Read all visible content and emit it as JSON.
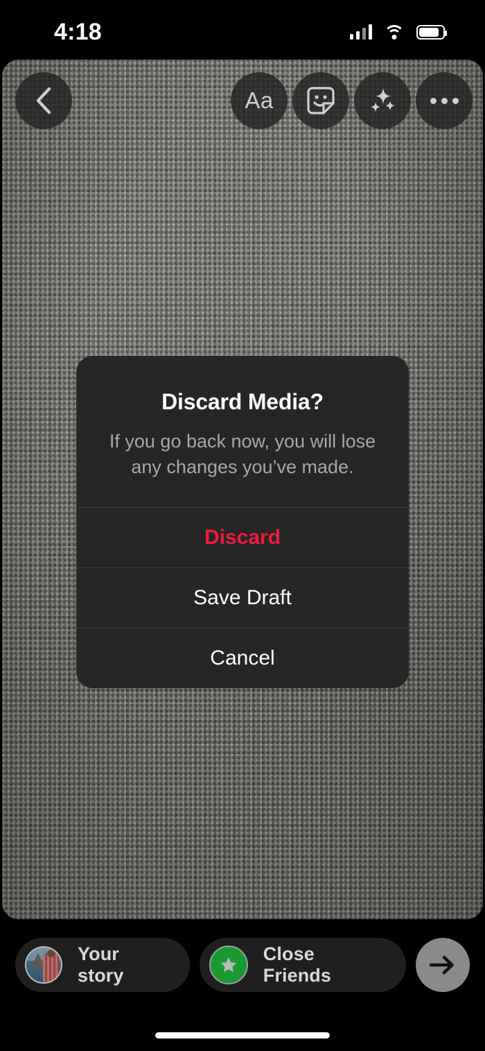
{
  "status_bar": {
    "time": "4:18",
    "icons": [
      "cellular-signal-icon",
      "wifi-icon",
      "battery-icon"
    ],
    "battery_level_percent": 85
  },
  "editor": {
    "toolbar": {
      "back_icon": "chevron-left-icon",
      "text_tool_label": "Aa",
      "text_tool_icon": "text-tool-icon",
      "sticker_icon": "sticker-icon",
      "effects_icon": "sparkles-icon",
      "more_icon": "more-horizontal-icon"
    },
    "media": {
      "description": "gray woven burlap fabric texture",
      "base_color": "#87867f"
    }
  },
  "dialog": {
    "title": "Discard Media?",
    "message": "If you go back now, you will lose any changes you’ve made.",
    "background_color": "#262626",
    "actions": [
      {
        "label": "Discard",
        "style": "destructive",
        "color": "#ED1B3A"
      },
      {
        "label": "Save Draft",
        "style": "default",
        "color": "#FFFFFF"
      },
      {
        "label": "Cancel",
        "style": "default",
        "color": "#FFFFFF"
      }
    ]
  },
  "bottom_bar": {
    "your_story": {
      "label": "Your story",
      "avatar_icon": "profile-avatar-thumbnail"
    },
    "close_friends": {
      "label": "Close Friends",
      "badge_icon": "green-star-badge-icon",
      "badge_color": "#1a9a32"
    },
    "send_button": {
      "icon": "arrow-right-icon",
      "background_color": "#8a8a8a"
    }
  },
  "home_indicator": {
    "name": "home-indicator"
  }
}
